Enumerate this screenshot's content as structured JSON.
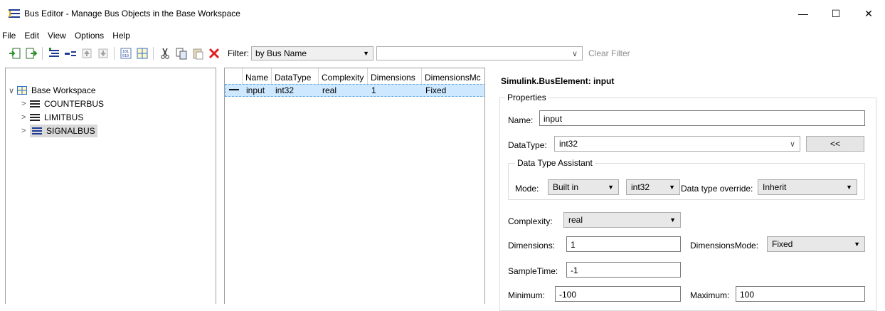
{
  "window": {
    "title": "Bus Editor - Manage Bus Objects in the Base Workspace",
    "minimize": "—",
    "maximize": "☐",
    "close": "✕"
  },
  "menu": [
    "File",
    "Edit",
    "View",
    "Options",
    "Help"
  ],
  "toolbar": {
    "icons": [
      "import-icon",
      "export-icon",
      "new-bus-icon",
      "new-element-icon",
      "move-up-icon",
      "move-down-icon",
      "create-matlab-file-icon",
      "grid-icon",
      "cut-icon",
      "copy-icon",
      "paste-icon",
      "delete-icon"
    ],
    "filter_label": "Filter:",
    "filter_mode": "by Bus Name",
    "filter_text": "",
    "clear_filter": "Clear Filter",
    "delete_color": "#e02020"
  },
  "tree": {
    "root": "Base Workspace",
    "children": [
      "COUNTERBUS",
      "LIMITBUS",
      "SIGNALBUS"
    ],
    "selected": "SIGNALBUS"
  },
  "table": {
    "columns": [
      "Name",
      "DataType",
      "Complexity",
      "Dimensions",
      "DimensionsMc"
    ],
    "rows": [
      {
        "name": "input",
        "datatype": "int32",
        "complexity": "real",
        "dimensions": "1",
        "dimensionsmode": "Fixed"
      }
    ]
  },
  "properties": {
    "object_title": "Simulink.BusElement: input",
    "group_label": "Properties",
    "name_label": "Name:",
    "name_value": "input",
    "datatype_label": "DataType:",
    "datatype_value": "int32",
    "assistant_toggle": "<<",
    "assistant_group": "Data Type Assistant",
    "mode_label": "Mode:",
    "mode_value": "Built in",
    "builtin_type": "int32",
    "override_label": "Data type override:",
    "override_value": "Inherit",
    "complexity_label": "Complexity:",
    "complexity_value": "real",
    "dimensions_label": "Dimensions:",
    "dimensions_value": "1",
    "dimmode_label": "DimensionsMode:",
    "dimmode_value": "Fixed",
    "sampletime_label": "SampleTime:",
    "sampletime_value": "-1",
    "minimum_label": "Minimum:",
    "minimum_value": "-100",
    "maximum_label": "Maximum:",
    "maximum_value": "100"
  }
}
